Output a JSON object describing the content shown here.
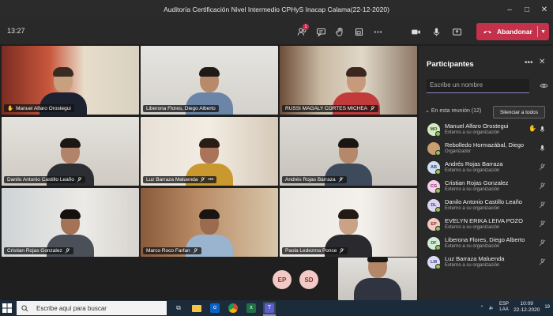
{
  "window": {
    "title": "Auditoría Certificación Nivel Intermedio CPHyS Inacap Calama(22-12-2020)",
    "controls": [
      "–",
      "□",
      "✕"
    ]
  },
  "toolbar": {
    "timer": "13:27",
    "participants_badge": "1",
    "leave_label": "Abandonar",
    "icons": [
      "participants-icon",
      "chat-icon",
      "raise-hand-icon",
      "share-tray-icon",
      "more-icon",
      "camera-icon",
      "mic-icon",
      "share-icon",
      "leave-phone-icon"
    ]
  },
  "video_tiles": [
    {
      "name": "Manuel Alfaro Orostegui",
      "hand": true
    },
    {
      "name": "Liberona Flores, Diego Alberto"
    },
    {
      "name": "RUSSI MAGALY CORTES MICHEA"
    },
    {
      "name": "Danilo Antonio Castillo Leaño"
    },
    {
      "name": "Luz Barraza Maluenda",
      "more": "•••"
    },
    {
      "name": "Andrés Rojas Barraza"
    },
    {
      "name": "Cristian Rojas Gonzalez"
    },
    {
      "name": "Marco Roco Farfan"
    },
    {
      "name": "Paola Ledezma Ponce"
    }
  ],
  "avatars_row": [
    {
      "initials": "EP"
    },
    {
      "initials": "SD"
    }
  ],
  "panel": {
    "title": "Participantes",
    "more": "•••",
    "close": "✕",
    "search_placeholder": "Escribe un nombre",
    "section_label": "En esta reunión (12)",
    "mute_all": "Silenciar a todos",
    "participants": [
      {
        "initials": "MO",
        "name": "Manuel Alfaro Orostegui",
        "sub": "Externo a su organización",
        "color": "#d6e8c4",
        "text": "#2e5c12",
        "hand": true,
        "mic": "on"
      },
      {
        "initials": "",
        "name": "Rebolledo Hormazábal, Diego",
        "sub": "Organizador",
        "color": "#c8a070",
        "text": "#fff",
        "photo": true,
        "mic": "on"
      },
      {
        "initials": "AB",
        "name": "Andrés Rojas Barraza",
        "sub": "Externo a su organización",
        "color": "#d5dff3",
        "text": "#2b4a8a",
        "mic": "off"
      },
      {
        "initials": "CG",
        "name": "Cristian Rojas Gonzalez",
        "sub": "Externo a su organización",
        "color": "#f3d1ea",
        "text": "#8a2b6e",
        "mic": "off"
      },
      {
        "initials": "DL",
        "name": "Danilo Antonio Castillo Leaño",
        "sub": "Externo a su organización",
        "color": "#dcd6f3",
        "text": "#4b3a8a",
        "mic": "off"
      },
      {
        "initials": "EP",
        "name": "EVELYN ERIKA LEIVA POZO",
        "sub": "Externo a su organización",
        "color": "#f1c9c5",
        "text": "#8a2e2a",
        "mic": "off"
      },
      {
        "initials": "DF",
        "name": "Liberona Flores, Diego Alberto",
        "sub": "Externo a su organización",
        "color": "#d3ecd8",
        "text": "#23603a",
        "mic": "off"
      },
      {
        "initials": "LM",
        "name": "Luz Barraza Maluenda",
        "sub": "Externo a su organización",
        "color": "#dcdcf3",
        "text": "#3a3a8a",
        "mic": "off"
      }
    ]
  },
  "taskbar": {
    "search_placeholder": "Escribe aquí para buscar",
    "lang_top": "ESP",
    "lang_bottom": "LAA",
    "time": "10:09",
    "date": "22-12-2020",
    "notif": "19"
  },
  "colors": {
    "accent": "#8b8cc7",
    "leave": "#c4314b",
    "panel_bg": "#292929",
    "app_bg": "#1f1f1f"
  }
}
